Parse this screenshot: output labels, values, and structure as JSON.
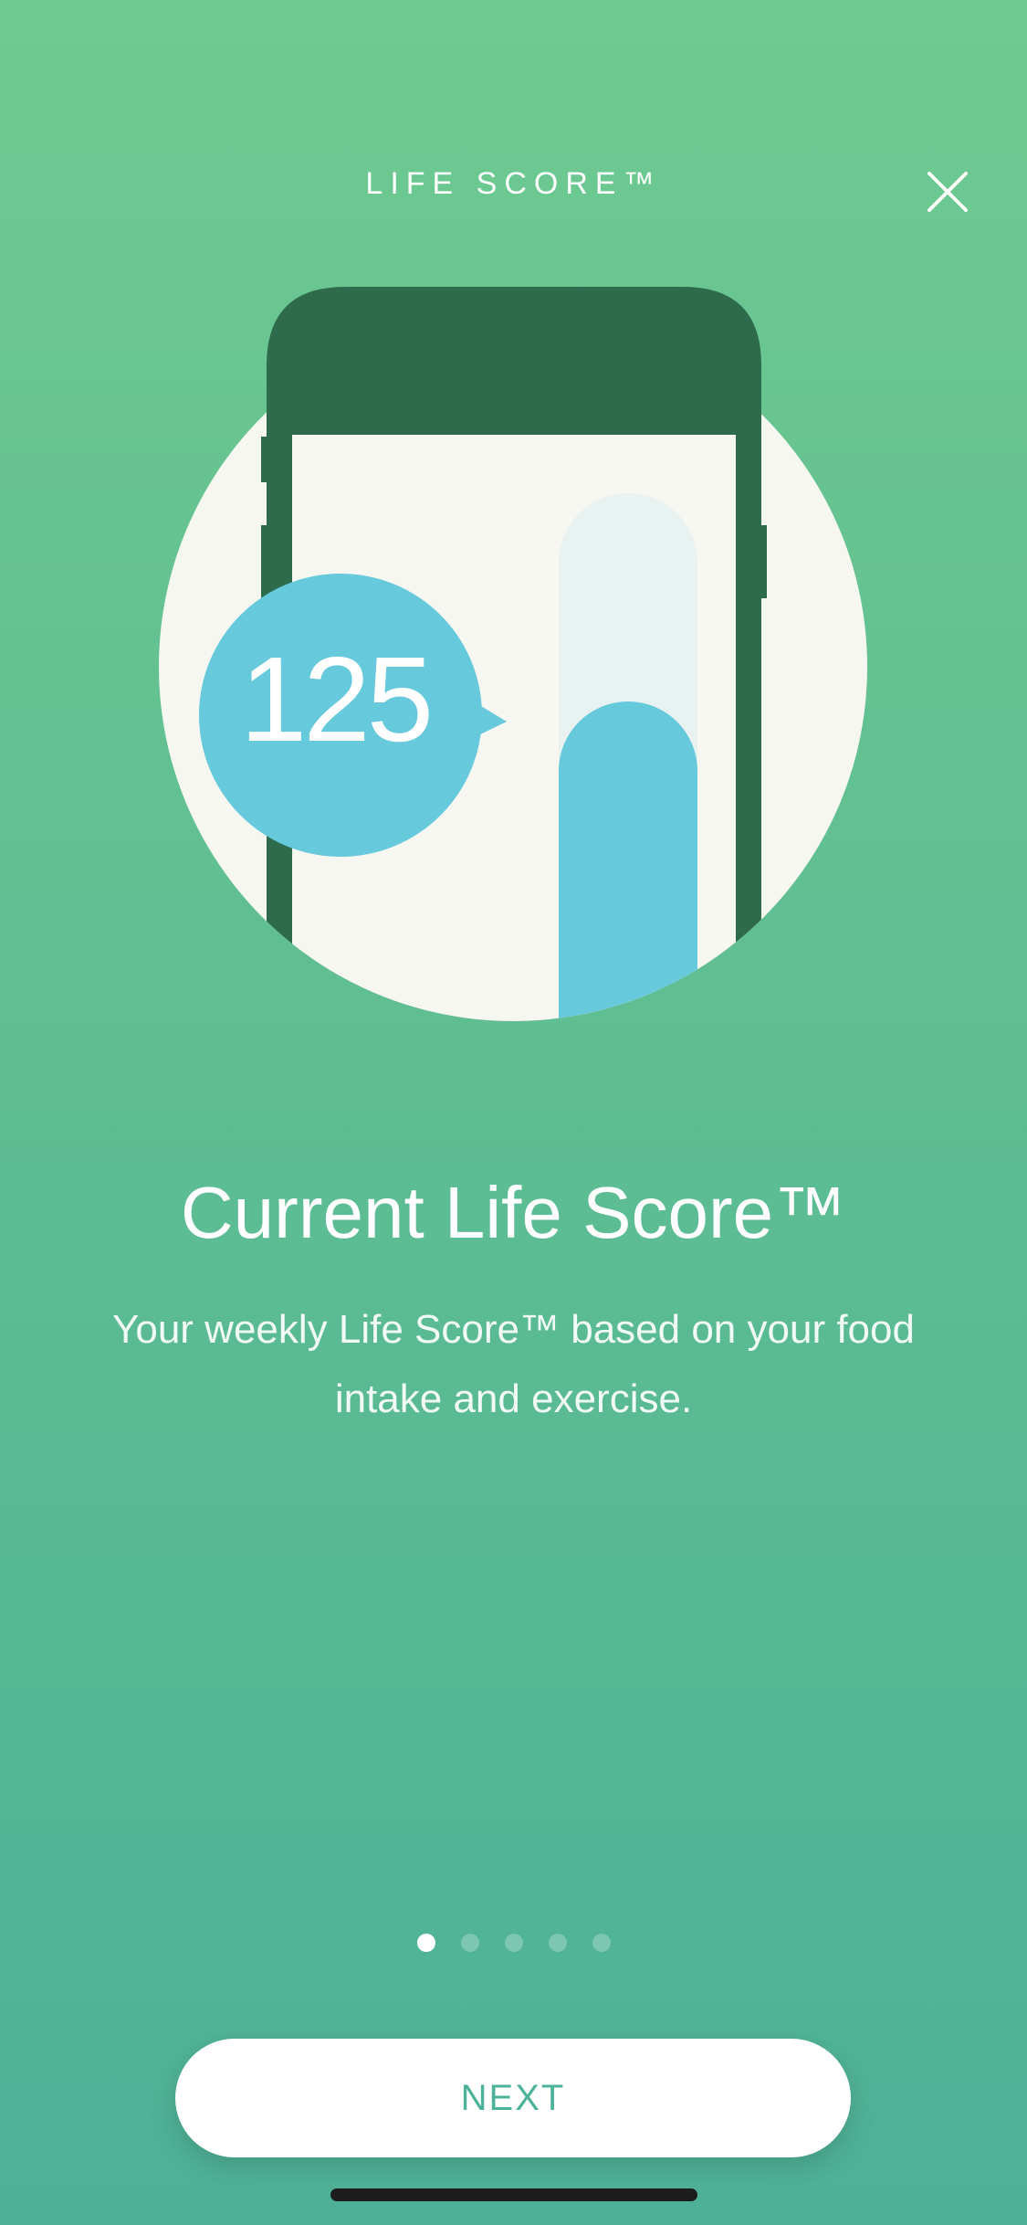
{
  "header": {
    "title": "LIFE SCORE™"
  },
  "close_icon": "close-icon",
  "illustration": {
    "score_value": "125",
    "colors": {
      "circle": "#F7F7F2",
      "phone": "#2E6B4D",
      "bubble": "#66C9DC",
      "bar_track": "#E8F2F0",
      "bar_fill": "#66C9DC"
    }
  },
  "content": {
    "headline": "Current Life Score™",
    "description": "Your weekly Life Score™ based on your food intake and exercise."
  },
  "pager": {
    "total": 5,
    "active_index": 0
  },
  "footer": {
    "next_label": "NEXT"
  },
  "colors": {
    "gradient_top": "#6ECA8F",
    "gradient_bottom": "#4EB197",
    "button_text": "#4DB29A"
  }
}
